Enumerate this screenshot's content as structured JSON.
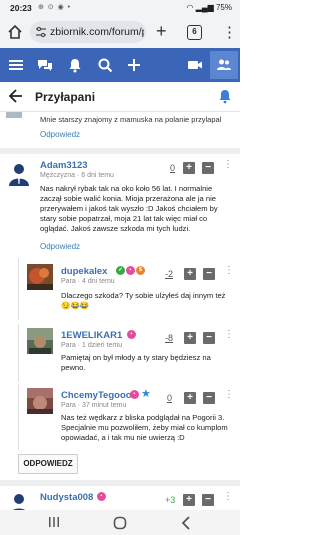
{
  "status_bar": {
    "time": "20:23",
    "battery": "75%"
  },
  "browser": {
    "url": "zbiornik.com/forum/p",
    "tab_count": "6"
  },
  "topic": {
    "title": "Przyłapani"
  },
  "prev_post": {
    "text": "Mnie starszy znajomy z mamuska na polanie przylapal",
    "reply_label": "Odpowiedz"
  },
  "posts": [
    {
      "author": "Adam3123",
      "meta": "Mężczyzna · 6 dni temu",
      "score": "0",
      "text": "Nas nakrył rybak tak na oko koło 56 lat. I normalnie zaczął sobie walić konia. Mioja przerażona ale ja nie przerywałem i jakoś tak wyszło :D Jakoś chciałem by stary sobie popatrzał, moja 21 lat tak więc miał co oglądać. Jakoś zawsze szkoda mi tych ludzi.",
      "reply_label": "Odpowiedz"
    },
    {
      "author": "dupekalex",
      "meta": "Para · 4 dni temu",
      "score": "-2",
      "text": "Dlaczego szkoda? Ty sobie ulżyłeś daj innym też 😏😂😂"
    },
    {
      "author": "1EWELIKAR1",
      "meta": "Para · 1 dzień temu",
      "score": "-8",
      "text": "Pamiętaj on był młody a ty stary będziesz na pewno."
    },
    {
      "author": "ChcemyTegooo",
      "meta": "Para · 37 minut temu",
      "score": "0",
      "text": "Nas też wędkarz z bliska podglądał na Pogorii 3. Specjalnie mu pozwoliłem, żeby miał co kumplom opowiadać, a i tak mu nie uwierzą :D"
    },
    {
      "author": "Nudysta008",
      "meta": "",
      "score": "+3",
      "text": ""
    }
  ],
  "reply_button": "ODPOWIEDZ",
  "colors": {
    "accent": "#3b66b8",
    "link": "#3b7fb6"
  }
}
